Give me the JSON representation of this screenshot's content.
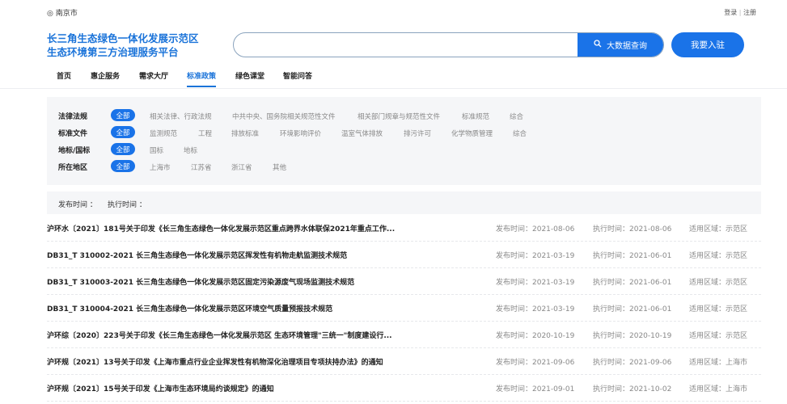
{
  "header": {
    "location": "南京市",
    "login": "登录",
    "sep": "|",
    "register": "注册",
    "title_line1": "长三角生态绿色一体化发展示范区",
    "title_line2": "生态环境第三方治理服务平台",
    "search_placeholder": "",
    "search_button": "大数据查询",
    "join_button": "我要入驻"
  },
  "nav": [
    "首页",
    "惠企服务",
    "需求大厅",
    "标准政策",
    "绿色课堂",
    "智能问答"
  ],
  "filters": [
    {
      "label": "法律法规",
      "all": "全部",
      "options": [
        "相关法律、行政法规",
        "中共中央、国务院相关规范性文件",
        "相关部门规章与规范性文件",
        "标准规范",
        "综合"
      ]
    },
    {
      "label": "标准文件",
      "all": "全部",
      "options": [
        "监测规范",
        "工程",
        "排放标准",
        "环境影响评价",
        "温室气体排放",
        "排污许可",
        "化学物质管理",
        "综合"
      ]
    },
    {
      "label": "地标/国标",
      "all": "全部",
      "options": [
        "国标",
        "地标"
      ]
    },
    {
      "label": "所在地区",
      "all": "全部",
      "options": [
        "上海市",
        "江苏省",
        "浙江省",
        "其他"
      ]
    }
  ],
  "sort": {
    "publish": "发布时间 ：",
    "execute": "执行时间 ："
  },
  "rows": [
    {
      "title": "沪环水〔2021〕181号关于印发《长三角生态绿色一体化发展示范区重点跨界水体联保2021年重点工作...",
      "publish": "发布时间：2021-08-06",
      "execute": "执行时间：2021-08-06",
      "region": "适用区域：示范区"
    },
    {
      "title": "DB31_T 310002-2021 长三角生态绿色一体化发展示范区挥发性有机物走航监测技术规范",
      "publish": "发布时间：2021-03-19",
      "execute": "执行时间：2021-06-01",
      "region": "适用区域：示范区"
    },
    {
      "title": "DB31_T 310003-2021 长三角生态绿色一体化发展示范区固定污染源废气现场监测技术规范",
      "publish": "发布时间：2021-03-19",
      "execute": "执行时间：2021-06-01",
      "region": "适用区域：示范区"
    },
    {
      "title": "DB31_T 310004-2021 长三角生态绿色一体化发展示范区环境空气质量预报技术规范",
      "publish": "发布时间：2021-03-19",
      "execute": "执行时间：2021-06-01",
      "region": "适用区域：示范区"
    },
    {
      "title": "沪环综〔2020〕223号关于印发《长三角生态绿色一体化发展示范区 生态环境管理\"三统一\"制度建设行...",
      "publish": "发布时间：2020-10-19",
      "execute": "执行时间：2020-10-19",
      "region": "适用区域：示范区"
    },
    {
      "title": "沪环规〔2021〕13号关于印发《上海市重点行业企业挥发性有机物深化治理项目专项扶持办法》的通知",
      "publish": "发布时间：2021-09-06",
      "execute": "执行时间：2021-09-06",
      "region": "适用区域：上海市"
    },
    {
      "title": "沪环规〔2021〕15号关于印发《上海市生态环境局约谈规定》的通知",
      "publish": "发布时间：2021-09-01",
      "execute": "执行时间：2021-10-02",
      "region": "适用区域：上海市"
    }
  ]
}
